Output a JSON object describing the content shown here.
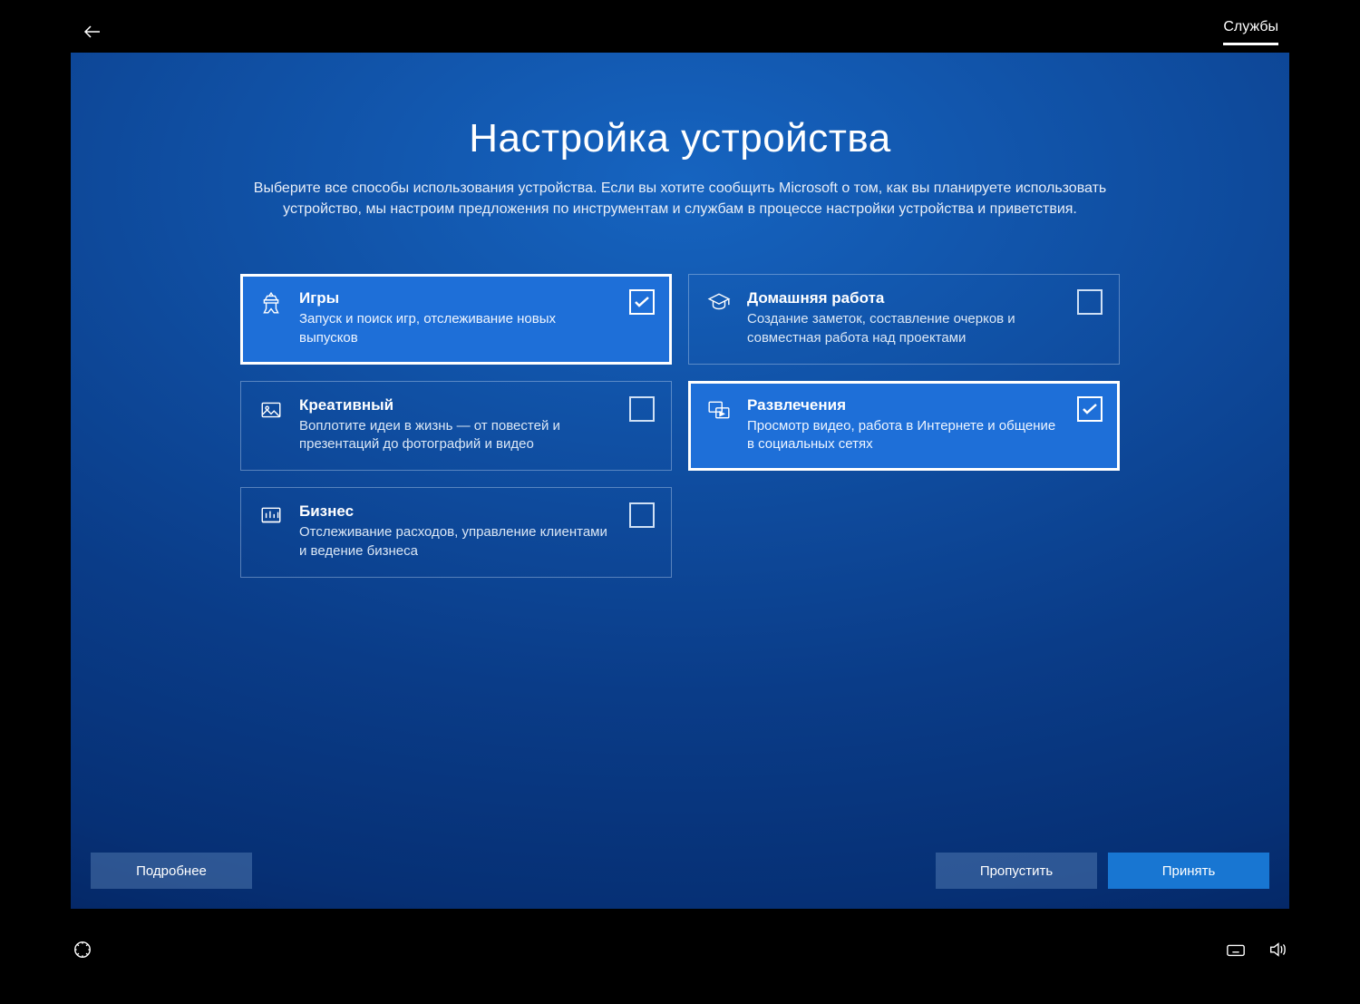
{
  "header": {
    "tab": "Службы"
  },
  "main": {
    "title": "Настройка устройства",
    "description": "Выберите все способы использования устройства. Если вы хотите сообщить Microsoft о том, как вы планируете использовать устройство, мы настроим предложения по инструментам и службам в процессе настройки устройства и приветствия."
  },
  "cards": [
    {
      "icon": "gaming",
      "title": "Игры",
      "desc": "Запуск и поиск игр, отслеживание новых выпусков",
      "selected": true
    },
    {
      "icon": "school",
      "title": "Домашняя работа",
      "desc": "Создание заметок, составление очерков и совместная работа над проектами",
      "selected": false
    },
    {
      "icon": "creative",
      "title": "Креативный",
      "desc": "Воплотите идеи в жизнь — от повестей и презентаций до фотографий и видео",
      "selected": false
    },
    {
      "icon": "entertainment",
      "title": "Развлечения",
      "desc": "Просмотр видео, работа в Интернете и общение в социальных сетях",
      "selected": true
    },
    {
      "icon": "business",
      "title": "Бизнес",
      "desc": "Отслеживание расходов, управление клиентами и ведение бизнеса",
      "selected": false
    }
  ],
  "footer": {
    "learn_more": "Подробнее",
    "skip": "Пропустить",
    "accept": "Принять"
  }
}
